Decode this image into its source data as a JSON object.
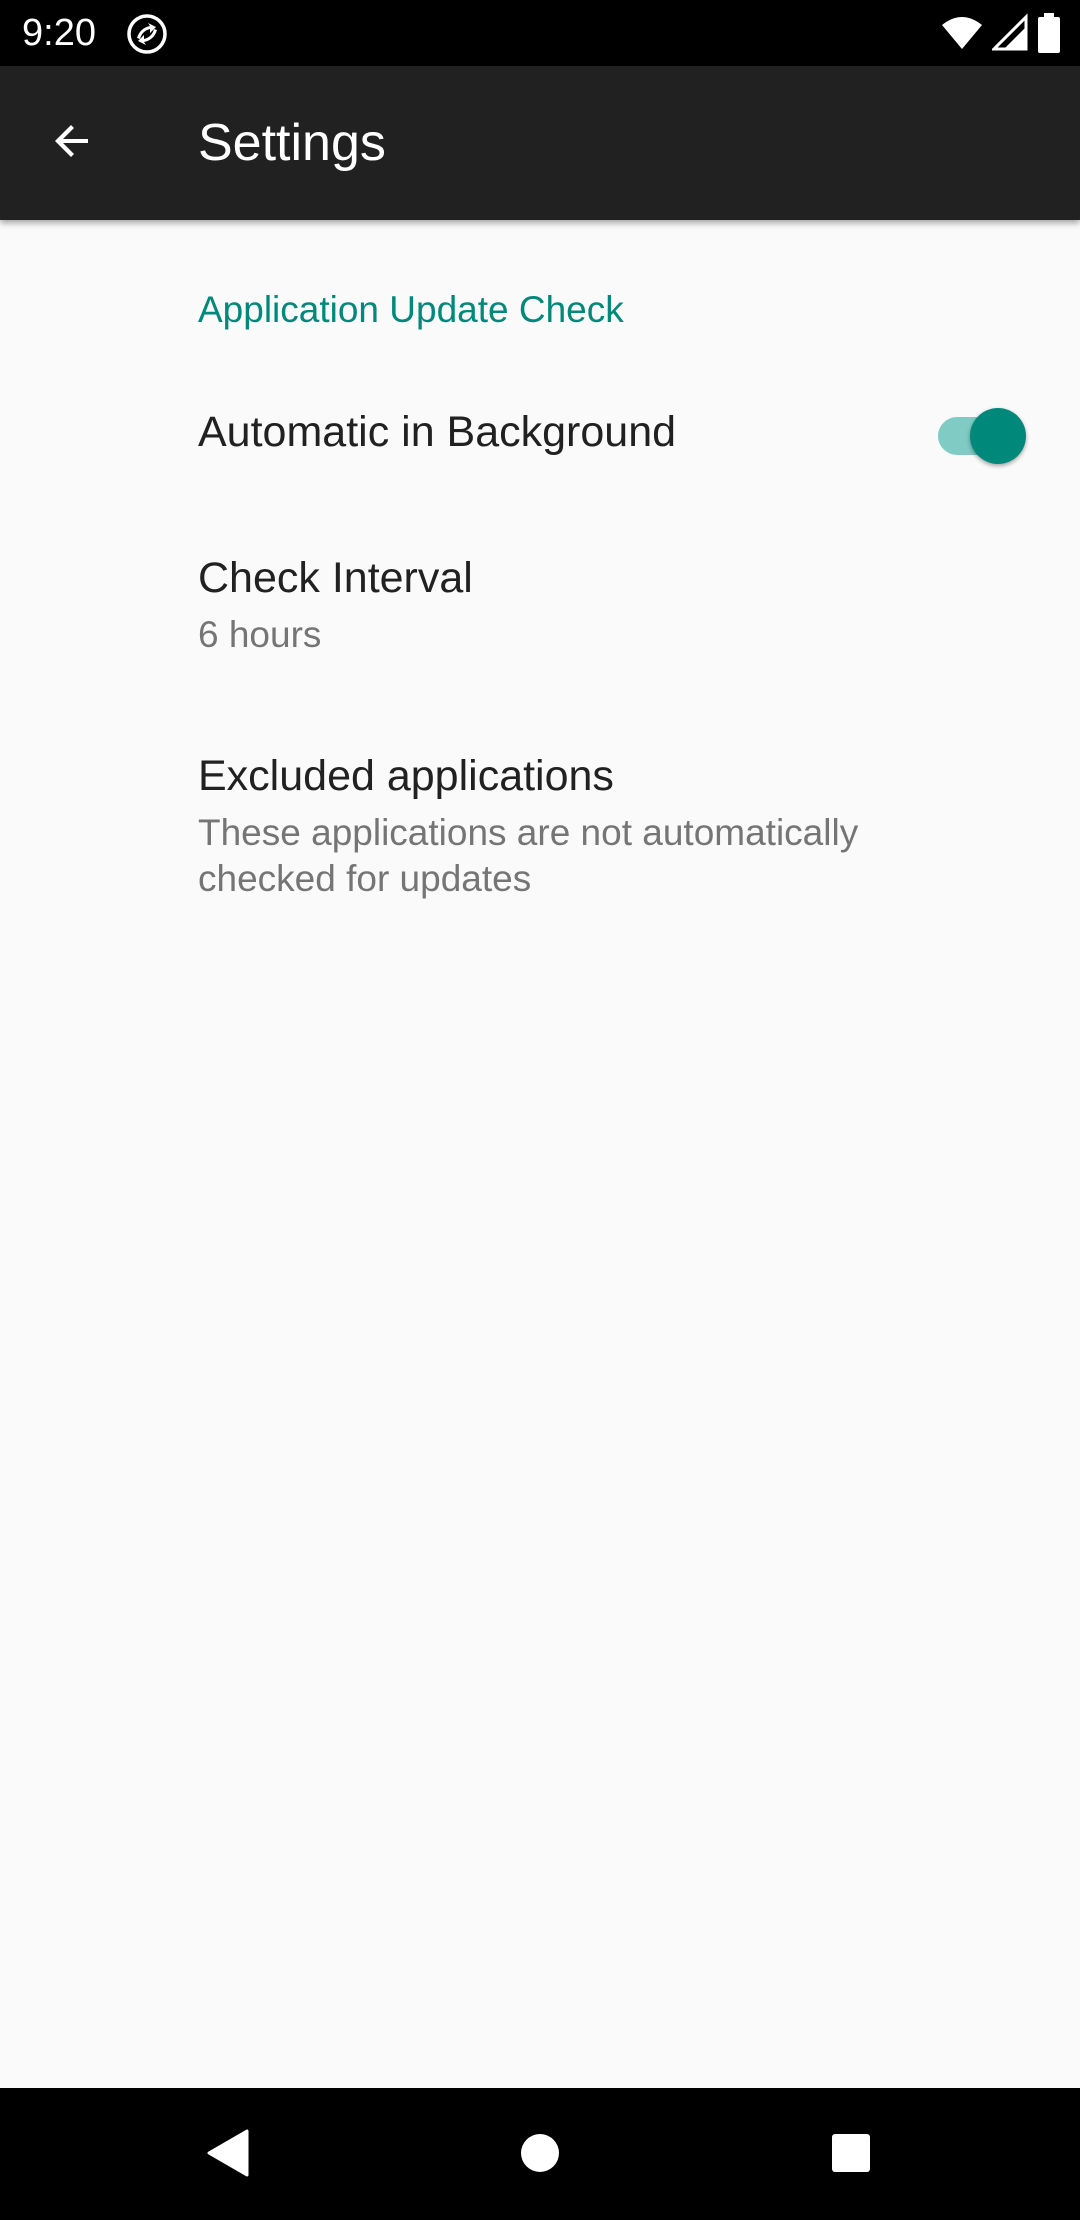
{
  "status_bar": {
    "time": "9:20",
    "icons": [
      "sync-app-icon",
      "wifi-icon",
      "cell-signal-icon",
      "battery-icon"
    ]
  },
  "app_bar": {
    "title": "Settings",
    "back_icon": "arrow-back-icon"
  },
  "settings": {
    "category_title": "Application Update Check",
    "automatic_background": {
      "title": "Automatic in Background",
      "enabled": true
    },
    "check_interval": {
      "title": "Check Interval",
      "summary": "6 hours"
    },
    "excluded_applications": {
      "title": "Excluded applications",
      "summary": "These applications are not automatically checked for updates"
    }
  },
  "nav_bar": {
    "icons": [
      "back-triangle-icon",
      "home-circle-icon",
      "recents-square-icon"
    ]
  },
  "colors": {
    "accent": "#00897b",
    "accent_light": "#80cbc4",
    "app_bar": "#212121",
    "background": "#fafafa"
  }
}
